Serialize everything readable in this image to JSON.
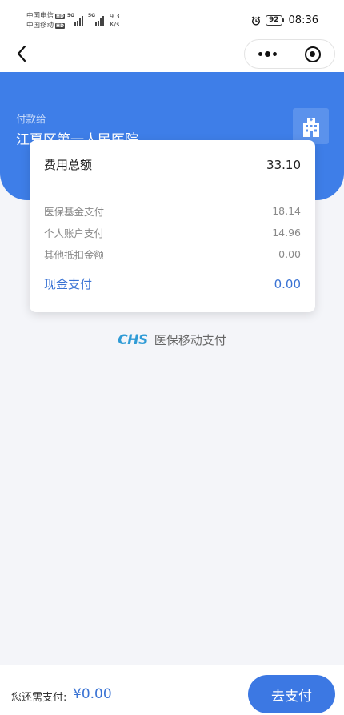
{
  "status_bar": {
    "carrier1": "中国电信",
    "carrier2": "中国移动",
    "hd": "HD",
    "net_type1": "5G",
    "net_type2": "5G",
    "speed_value": "9.3",
    "speed_unit": "K/s",
    "battery": "92",
    "time": "08:36"
  },
  "hero": {
    "pay_to_label": "付款给",
    "payee": "江夏区第一人民医院"
  },
  "summary": {
    "total_label": "费用总额",
    "total_value": "33.10",
    "items": [
      {
        "label": "医保基金支付",
        "value": "18.14"
      },
      {
        "label": "个人账户支付",
        "value": "14.96"
      },
      {
        "label": "其他抵扣金额",
        "value": "0.00"
      }
    ],
    "cash_label": "现金支付",
    "cash_value": "0.00"
  },
  "brand": {
    "logo": "CHS",
    "text": "医保移动支付"
  },
  "footer": {
    "due_label": "您还需支付:",
    "due_amount": "¥0.00",
    "pay_button": "去支付"
  },
  "colors": {
    "primary": "#3e7ee8",
    "accent_text": "#3a73d4",
    "brand_logo": "#2f9bd6",
    "background": "#f4f5f9"
  },
  "icons": [
    "alarm-clock-icon",
    "battery-icon",
    "signal-icon",
    "back-arrow-icon",
    "more-dots-icon",
    "target-close-icon",
    "hospital-building-icon"
  ]
}
